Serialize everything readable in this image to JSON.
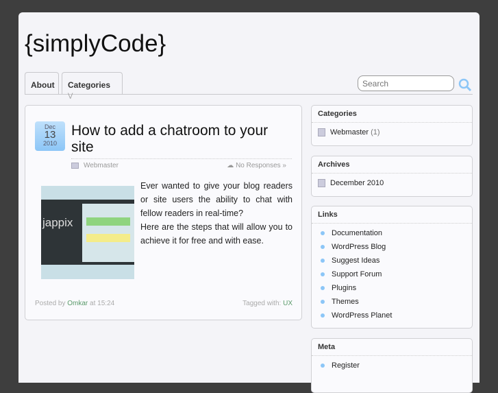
{
  "site": {
    "logo": "{simplyCode}"
  },
  "nav": {
    "about": "About",
    "categories": "Categories",
    "search_placeholder": "Search"
  },
  "post": {
    "month": "Dec",
    "day": "13",
    "year": "2010",
    "title": "How to add a chatroom to your site",
    "category": "Webmaster",
    "responses": "No Responses »",
    "image_text": "jappix",
    "body1": "Ever wanted to give your blog readers or site users the ability to chat with fellow readers in real-time?",
    "body2": "Here are the steps that will allow you to achieve it for free and with ease.",
    "posted_by": "Posted by",
    "author": "Omkar",
    "at": "at 15:24",
    "tagged": "Tagged with:",
    "tag": "UX"
  },
  "sidebar": {
    "categories": {
      "title": "Categories",
      "item": "Webmaster",
      "count": "(1)"
    },
    "archives": {
      "title": "Archives",
      "item": "December 2010"
    },
    "links": {
      "title": "Links",
      "items": [
        "Documentation",
        "WordPress Blog",
        "Suggest Ideas",
        "Support Forum",
        "Plugins",
        "Themes",
        "WordPress Planet"
      ]
    },
    "meta": {
      "title": "Meta",
      "items": [
        "Register"
      ]
    }
  }
}
